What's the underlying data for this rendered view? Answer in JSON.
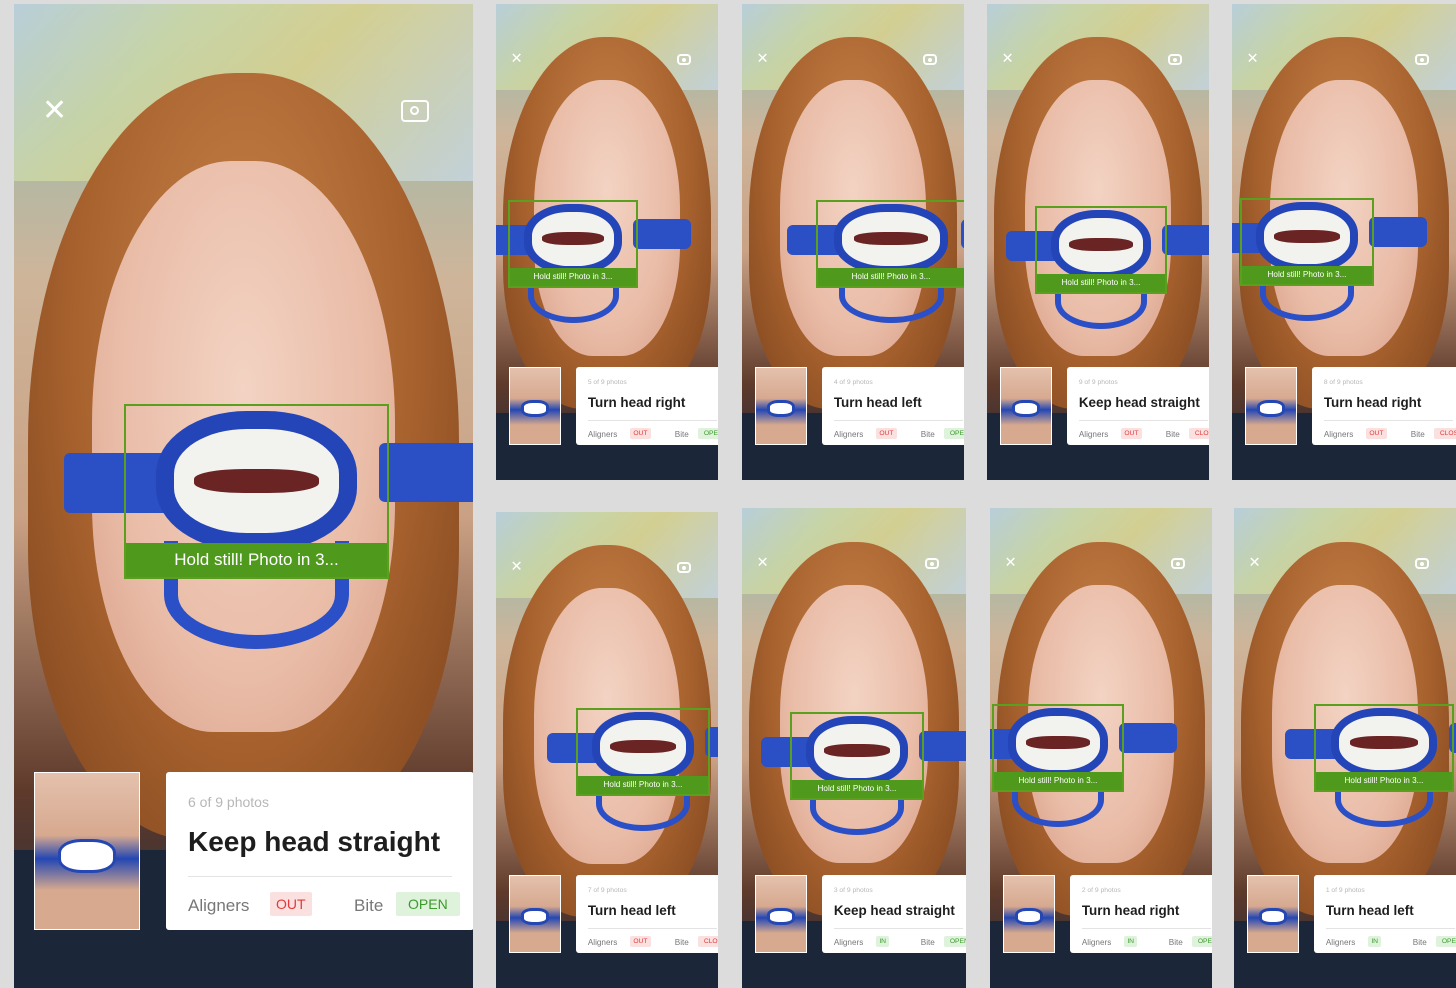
{
  "screens": [
    {
      "count": "6 of 9 photos",
      "title": "Keep head straight",
      "aligners_label": "Aligners",
      "aligners": "OUT",
      "bite_label": "Bite",
      "bite": "OPEN",
      "guide": "Hold still! Photo in 3...",
      "close": "✕"
    },
    {
      "count": "5 of 9 photos",
      "title": "Turn head right",
      "aligners_label": "Aligners",
      "aligners": "OUT",
      "bite_label": "Bite",
      "bite": "OPEN",
      "guide": "Hold still! Photo in 3...",
      "close": "✕"
    },
    {
      "count": "4 of 9 photos",
      "title": "Turn head left",
      "aligners_label": "Aligners",
      "aligners": "OUT",
      "bite_label": "Bite",
      "bite": "OPEN",
      "guide": "Hold still! Photo in 3...",
      "close": "✕"
    },
    {
      "count": "9 of 9 photos",
      "title": "Keep head straight",
      "aligners_label": "Aligners",
      "aligners": "OUT",
      "bite_label": "Bite",
      "bite": "CLOSED",
      "guide": "Hold still! Photo in 3...",
      "close": "✕"
    },
    {
      "count": "8 of 9 photos",
      "title": "Turn head right",
      "aligners_label": "Aligners",
      "aligners": "OUT",
      "bite_label": "Bite",
      "bite": "CLOSED",
      "guide": "Hold still! Photo in 3...",
      "close": "✕"
    },
    {
      "count": "7 of 9 photos",
      "title": "Turn head left",
      "aligners_label": "Aligners",
      "aligners": "OUT",
      "bite_label": "Bite",
      "bite": "CLOSED",
      "guide": "Hold still! Photo in 3...",
      "close": "✕"
    },
    {
      "count": "3 of 9 photos",
      "title": "Keep head straight",
      "aligners_label": "Aligners",
      "aligners": "IN",
      "bite_label": "Bite",
      "bite": "OPEN",
      "guide": "Hold still! Photo in 3...",
      "close": "✕"
    },
    {
      "count": "2 of 9 photos",
      "title": "Turn head right",
      "aligners_label": "Aligners",
      "aligners": "IN",
      "bite_label": "Bite",
      "bite": "OPEN",
      "guide": "Hold still! Photo in 3...",
      "close": "✕"
    },
    {
      "count": "1 of 9 photos",
      "title": "Turn head left",
      "aligners_label": "Aligners",
      "aligners": "IN",
      "bite_label": "Bite",
      "bite": "OPEN",
      "guide": "Hold still! Photo in 3...",
      "close": "✕"
    }
  ],
  "icons": {
    "close": "close-icon",
    "camera": "camera-switch-icon"
  },
  "colors": {
    "guide_green": "#4f9a1c",
    "retractor_blue": "#2445b8",
    "badge_red": "#e23a3a",
    "badge_green": "#3c9a2d"
  }
}
